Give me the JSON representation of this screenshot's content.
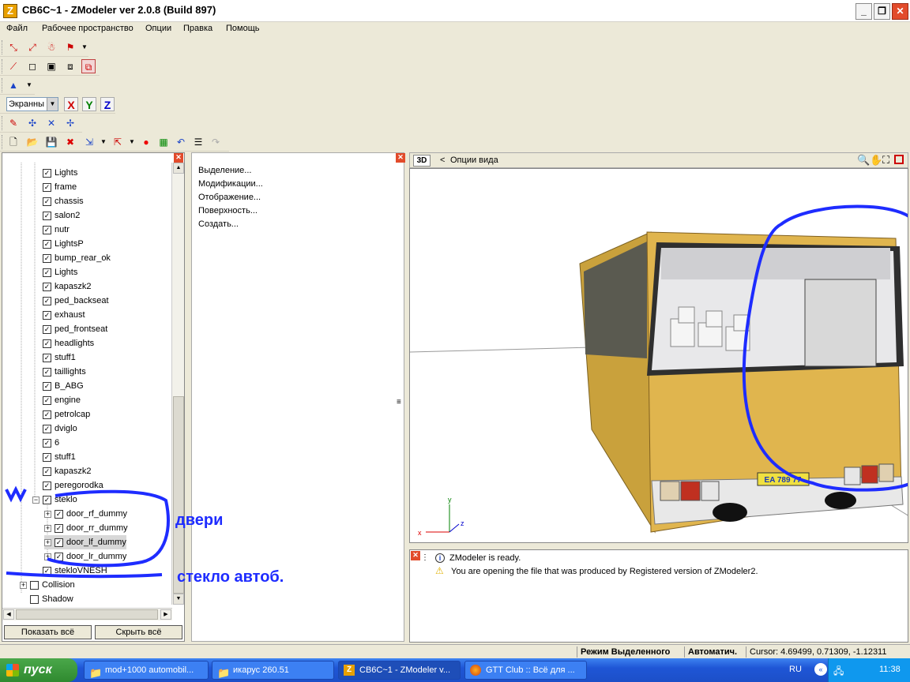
{
  "window": {
    "title": "CB6C~1 - ZModeler ver 2.0.8 (Build 897)",
    "logo": "Z"
  },
  "menu": [
    "Файл",
    "Рабочее пространство",
    "Опции",
    "Правка",
    "Помощь"
  ],
  "toolbar": {
    "coord_system": "Экранны",
    "axes": [
      "X",
      "Y",
      "Z"
    ],
    "axis_colors": {
      "X": "#d00000",
      "Y": "#008000",
      "Z": "#0000cc"
    }
  },
  "tree": {
    "items": [
      {
        "label": "Lights",
        "checked": true
      },
      {
        "label": "frame",
        "checked": true
      },
      {
        "label": "chassis",
        "checked": true
      },
      {
        "label": "salon2",
        "checked": true
      },
      {
        "label": "nutr",
        "checked": true
      },
      {
        "label": "LightsP",
        "checked": true
      },
      {
        "label": "bump_rear_ok",
        "checked": true
      },
      {
        "label": "Lights",
        "checked": true
      },
      {
        "label": "kapaszk2",
        "checked": true
      },
      {
        "label": "ped_backseat",
        "checked": true
      },
      {
        "label": "exhaust",
        "checked": true
      },
      {
        "label": "ped_frontseat",
        "checked": true
      },
      {
        "label": "headlights",
        "checked": true
      },
      {
        "label": "stuff1",
        "checked": true
      },
      {
        "label": "taillights",
        "checked": true
      },
      {
        "label": "B_ABG",
        "checked": true
      },
      {
        "label": "engine",
        "checked": true
      },
      {
        "label": "petrolcap",
        "checked": true
      },
      {
        "label": "dviglo",
        "checked": true
      },
      {
        "label": "6",
        "checked": true
      },
      {
        "label": "stuff1",
        "checked": true
      },
      {
        "label": "kapaszk2",
        "checked": true
      },
      {
        "label": "peregorodka",
        "checked": true
      },
      {
        "label": "steklo",
        "checked": true
      },
      {
        "label": "door_rf_dummy",
        "checked": true
      },
      {
        "label": "door_rr_dummy",
        "checked": true
      },
      {
        "label": "door_lf_dummy",
        "checked": true
      },
      {
        "label": "door_lr_dummy",
        "checked": true
      },
      {
        "label": "stekloVNESH",
        "checked": true
      },
      {
        "label": "Collision",
        "checked": false
      },
      {
        "label": "Shadow",
        "checked": false
      }
    ],
    "show_all": "Показать всё",
    "hide_all": "Скрыть всё"
  },
  "options_panel": [
    "Выделение...",
    "Модификации...",
    "Отображение...",
    "Поверхность...",
    "Создать..."
  ],
  "viewport": {
    "mode": "3D",
    "back": "<",
    "view_options": "Опции вида",
    "plate": "EA 789 77",
    "axis_labels": {
      "x": "x",
      "y": "y",
      "z": "z"
    }
  },
  "log": [
    {
      "icon": "info-icon",
      "text": "ZModeler is ready."
    },
    {
      "icon": "warning-icon",
      "text": "You are opening the file that was produced by Registered version of ZModeler2."
    }
  ],
  "status": {
    "mode": "Режим Выделенного",
    "auto": "Автоматич.",
    "cursor": "Cursor: 4.69499, 0.71309, -1.12311"
  },
  "annotations": {
    "doors": "двери",
    "glass": "стекло автоб."
  },
  "taskbar": {
    "start": "пуск",
    "tasks": [
      "mod+1000 automobil...",
      "икарус 260.51",
      "CB6C~1 - ZModeler v...",
      "GTT Club :: Всё для ..."
    ],
    "lang": "RU",
    "clock": "11:38"
  }
}
